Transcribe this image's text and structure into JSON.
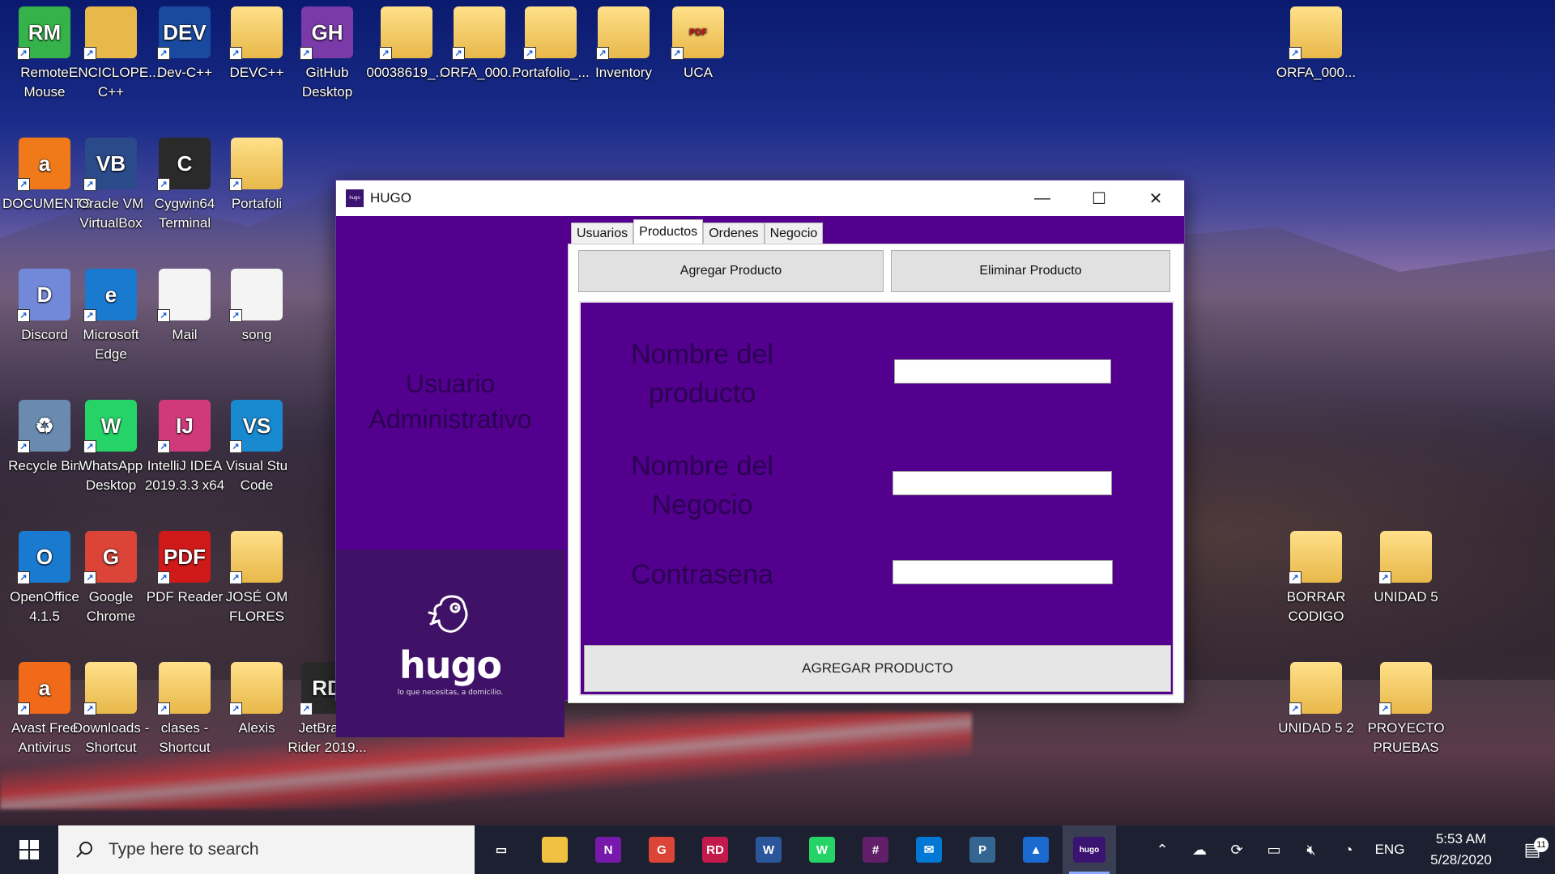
{
  "desktop": {
    "icons": [
      {
        "label": "Remote Mouse",
        "glyph": "RM",
        "color": "#35b34a"
      },
      {
        "label": "ENCICLOPE... C++",
        "glyph": "",
        "color": "#e8b84a"
      },
      {
        "label": "Dev-C++",
        "glyph": "DEV",
        "color": "#1a4aa0"
      },
      {
        "label": "DEVC++",
        "glyph": "",
        "color": "folder"
      },
      {
        "label": "GitHub Desktop",
        "glyph": "GH",
        "color": "#7a3aa8"
      },
      {
        "label": "00038619_...",
        "glyph": "",
        "color": "folder"
      },
      {
        "label": "ORFA_000...",
        "glyph": "",
        "color": "folder"
      },
      {
        "label": "Portafolio_...",
        "glyph": "",
        "color": "folder"
      },
      {
        "label": "Inventory",
        "glyph": "",
        "color": "folder"
      },
      {
        "label": "UCA",
        "glyph": "PDF",
        "color": "folder"
      },
      {
        "label": "ORFA_000...",
        "glyph": "",
        "color": "folder"
      },
      {
        "label": "DOCUMENTS",
        "glyph": "a",
        "color": "#f07a1a"
      },
      {
        "label": "Oracle VM VirtualBox",
        "glyph": "VB",
        "color": "#2a4a8a"
      },
      {
        "label": "Cygwin64 Terminal",
        "glyph": "C",
        "color": "#2a2a2a"
      },
      {
        "label": "Portafoli",
        "glyph": "",
        "color": "folder"
      },
      {
        "label": "Discord",
        "glyph": "D",
        "color": "#7289da"
      },
      {
        "label": "Microsoft Edge",
        "glyph": "e",
        "color": "#1a7ad0"
      },
      {
        "label": "Mail",
        "glyph": "",
        "color": "file"
      },
      {
        "label": "song",
        "glyph": "",
        "color": "file"
      },
      {
        "label": "Recycle Bin",
        "glyph": "♻",
        "color": "#6a8ab0"
      },
      {
        "label": "WhatsApp Desktop",
        "glyph": "W",
        "color": "#25d366"
      },
      {
        "label": "IntelliJ IDEA 2019.3.3 x64",
        "glyph": "IJ",
        "color": "#d03a7a"
      },
      {
        "label": "Visual Stu Code",
        "glyph": "VS",
        "color": "#1a8ad0"
      },
      {
        "label": "OpenOffice 4.1.5",
        "glyph": "O",
        "color": "#1a7ad0"
      },
      {
        "label": "Google Chrome",
        "glyph": "G",
        "color": "#db4437"
      },
      {
        "label": "PDF Reader",
        "glyph": "PDF",
        "color": "#d01a1a"
      },
      {
        "label": "JOSÉ OM FLORES",
        "glyph": "",
        "color": "folder"
      },
      {
        "label": "BORRAR CODIGO",
        "glyph": "",
        "color": "folder"
      },
      {
        "label": "UNIDAD 5",
        "glyph": "",
        "color": "folder"
      },
      {
        "label": "Avast Free Antivirus",
        "glyph": "a",
        "color": "#f06a1a"
      },
      {
        "label": "Downloads - Shortcut",
        "glyph": "",
        "color": "folder"
      },
      {
        "label": "clases - Shortcut",
        "glyph": "",
        "color": "folder"
      },
      {
        "label": "Alexis",
        "glyph": "",
        "color": "folder"
      },
      {
        "label": "JetBrains Rider 2019...",
        "glyph": "RD",
        "color": "#2a2a2a"
      },
      {
        "label": "UNIDAD 5 2",
        "glyph": "",
        "color": "folder"
      },
      {
        "label": "PROYECTO PRUEBAS",
        "glyph": "",
        "color": "folder"
      }
    ]
  },
  "window": {
    "title": "HUGO",
    "app_icon_text": "hugo",
    "minimize": "—",
    "maximize": "☐",
    "close": "✕",
    "sidebar": {
      "user_label": "Usuario Administrativo",
      "logo_text": "hugo",
      "logo_tagline": "lo que necesitas, a domicilio."
    },
    "tabs": [
      {
        "label": "Usuarios",
        "active": false
      },
      {
        "label": "Productos",
        "active": true
      },
      {
        "label": "Ordenes",
        "active": false
      },
      {
        "label": "Negocio",
        "active": false
      }
    ],
    "actions": {
      "add_label": "Agregar Producto",
      "remove_label": "Eliminar Producto"
    },
    "form": {
      "product_name_label": "Nombre del producto",
      "product_name_value": "",
      "business_name_label": "Nombre del Negocio",
      "business_name_value": "",
      "password_label": "Contrasena",
      "password_value": "",
      "submit_label": "AGREGAR PRODUCTO"
    }
  },
  "taskbar": {
    "search_placeholder": "Type here to search",
    "apps": [
      {
        "name": "task-view",
        "glyph": "▭",
        "color": "transparent"
      },
      {
        "name": "file-explorer",
        "glyph": "",
        "color": "#f0c040"
      },
      {
        "name": "onenote",
        "glyph": "N",
        "color": "#7719aa"
      },
      {
        "name": "chrome",
        "glyph": "G",
        "color": "#db4437"
      },
      {
        "name": "rider",
        "glyph": "RD",
        "color": "#c21a4a"
      },
      {
        "name": "word",
        "glyph": "W",
        "color": "#2b579a"
      },
      {
        "name": "whatsapp",
        "glyph": "W",
        "color": "#25d366"
      },
      {
        "name": "slack",
        "glyph": "#",
        "color": "#611f69"
      },
      {
        "name": "mail",
        "glyph": "✉",
        "color": "#0078d4"
      },
      {
        "name": "postgres",
        "glyph": "P",
        "color": "#336791"
      },
      {
        "name": "photos",
        "glyph": "▲",
        "color": "#1a6ad0"
      },
      {
        "name": "hugo",
        "glyph": "hugo",
        "color": "#3a1470",
        "active": true
      }
    ],
    "tray": {
      "language": "ENG",
      "time": "5:53 AM",
      "date": "5/28/2020",
      "notification_count": "11"
    }
  }
}
